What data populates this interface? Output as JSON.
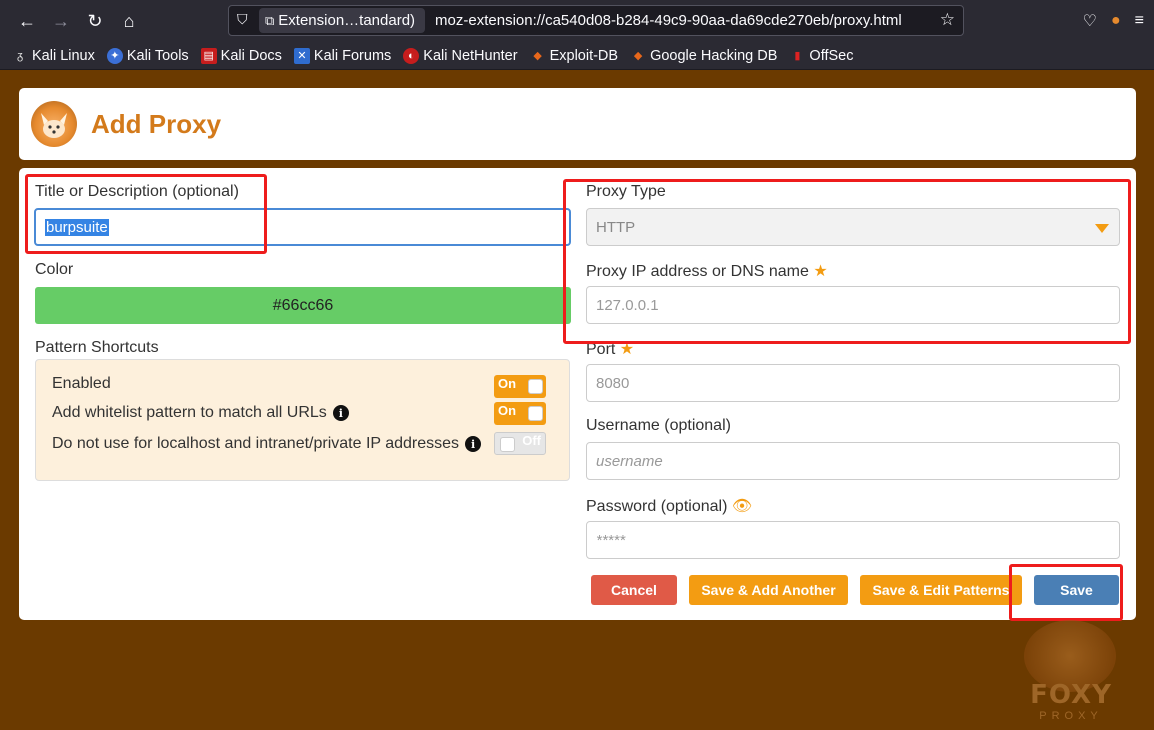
{
  "browser": {
    "identity_label": "Extension…tandard)",
    "url": "moz-extension://ca540d08-b284-49c9-90aa-da69cde270eb/proxy.html",
    "bookmarks": [
      {
        "label": "Kali Linux",
        "icon": "kali-dragon-icon"
      },
      {
        "label": "Kali Tools",
        "icon": "kali-tools-icon"
      },
      {
        "label": "Kali Docs",
        "icon": "kali-docs-icon"
      },
      {
        "label": "Kali Forums",
        "icon": "kali-forums-icon"
      },
      {
        "label": "Kali NetHunter",
        "icon": "nethunter-icon"
      },
      {
        "label": "Exploit-DB",
        "icon": "exploit-db-icon"
      },
      {
        "label": "Google Hacking DB",
        "icon": "ghdb-icon"
      },
      {
        "label": "OffSec",
        "icon": "offsec-icon"
      }
    ]
  },
  "header": {
    "title": "Add Proxy"
  },
  "form": {
    "title_label": "Title or Description (optional)",
    "title_value": "burpsuite",
    "color_label": "Color",
    "color_value": "#66cc66",
    "shortcuts_label": "Pattern Shortcuts",
    "shortcuts": [
      {
        "label": "Enabled",
        "state": "On",
        "info": false
      },
      {
        "label": "Add whitelist pattern to match all URLs",
        "state": "On",
        "info": true
      },
      {
        "label": "Do not use for localhost and intranet/private IP addresses",
        "state": "Off",
        "info": true
      }
    ],
    "proxy_type_label": "Proxy Type",
    "proxy_type_value": "HTTP",
    "ip_label": "Proxy IP address or DNS name",
    "ip_placeholder": "127.0.0.1",
    "port_label": "Port",
    "port_placeholder": "8080",
    "username_label": "Username (optional)",
    "username_placeholder": "username",
    "password_label": "Password (optional)",
    "password_placeholder": "*****"
  },
  "buttons": {
    "cancel": "Cancel",
    "save_add_another": "Save & Add Another",
    "save_edit_patterns": "Save & Edit Patterns",
    "save": "Save"
  },
  "watermark": {
    "brand": "FOXY",
    "sub": "PROXY"
  },
  "colors": {
    "accent": "#f39c12",
    "title": "#d37a1b",
    "background": "#6b3a00",
    "save": "#4a7fb5",
    "cancel": "#e05a47",
    "highlight": "#ee1c1c"
  }
}
